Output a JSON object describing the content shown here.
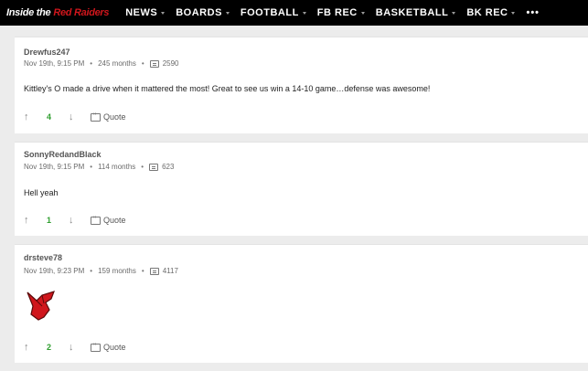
{
  "nav": {
    "brand_white": "Inside the",
    "brand_red": "Red Raiders",
    "items": [
      {
        "label": "NEWS"
      },
      {
        "label": "BOARDS"
      },
      {
        "label": "FOOTBALL"
      },
      {
        "label": "FB REC"
      },
      {
        "label": "BASKETBALL"
      },
      {
        "label": "BK REC"
      }
    ],
    "more": "•••"
  },
  "posts": [
    {
      "author": "Drewfus247",
      "date": "Nov 19th, 9:15 PM",
      "tenure": "245 months",
      "post_count": "2590",
      "body": "Kittley's O made a drive when it mattered the most! Great to see us win a 14-10 game…defense was awesome!",
      "votes": "4",
      "quote_label": "Quote"
    },
    {
      "author": "SonnyRedandBlack",
      "date": "Nov 19th, 9:15 PM",
      "tenure": "114 months",
      "post_count": "623",
      "body": "Hell yeah",
      "votes": "1",
      "quote_label": "Quote"
    },
    {
      "author": "drsteve78",
      "date": "Nov 19th, 9:23 PM",
      "tenure": "159 months",
      "post_count": "4117",
      "body": "",
      "votes": "2",
      "quote_label": "Quote"
    }
  ],
  "icons": {
    "upvote": "↑",
    "downvote": "↓",
    "separator": "•"
  },
  "colors": {
    "nav_bg": "#000000",
    "brand_red": "#d0161c",
    "vote_green": "#2f9e2f",
    "emoji_red": "#d0161c"
  }
}
